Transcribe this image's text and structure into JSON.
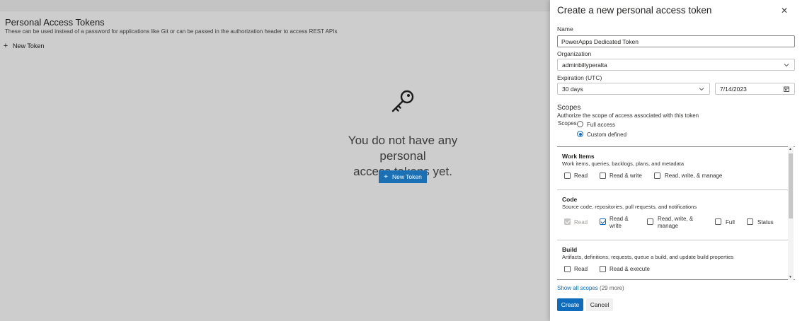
{
  "background": {
    "page_title": "Personal Access Tokens",
    "page_subtitle": "These can be used instead of a password for applications like Git or can be passed in the authorization header to access REST APIs",
    "new_token_link": "New Token",
    "empty_message_line1": "You do not have any personal",
    "empty_message_line2": "access tokens yet.",
    "new_token_button": "New Token",
    "empty_icon": "key-icon"
  },
  "panel": {
    "title": "Create a new personal access token",
    "close_icon": "close-icon",
    "name_label": "Name",
    "name_value": "PowerApps Dedicated Token",
    "organization_label": "Organization",
    "organization_value": "adminbillyperalta",
    "expiration_label": "Expiration (UTC)",
    "expiration_value": "30 days",
    "expiration_date": "7/14/2023",
    "scopes_heading": "Scopes",
    "scopes_description": "Authorize the scope of access associated with this token",
    "scopes_radio_label": "Scopes",
    "radio_full": "Full access",
    "radio_custom": "Custom defined",
    "selected_radio": "Custom defined",
    "sections": [
      {
        "name": "Work Items",
        "description": "Work items, queries, backlogs, plans, and metadata",
        "options": [
          {
            "label": "Read",
            "checked": false,
            "disabled": false
          },
          {
            "label": "Read & write",
            "checked": false,
            "disabled": false
          },
          {
            "label": "Read, write, & manage",
            "checked": false,
            "disabled": false
          }
        ]
      },
      {
        "name": "Code",
        "description": "Source code, repositories, pull requests, and notifications",
        "options": [
          {
            "label": "Read",
            "checked": true,
            "disabled": true
          },
          {
            "label_line1": "Read &",
            "label_line2": "write",
            "checked": true,
            "disabled": false
          },
          {
            "label_line1": "Read, write, &",
            "label_line2": "manage",
            "checked": false,
            "disabled": false
          },
          {
            "label": "Full",
            "checked": false,
            "disabled": false
          },
          {
            "label": "Status",
            "checked": false,
            "disabled": false
          }
        ]
      },
      {
        "name": "Build",
        "description": "Artifacts, definitions, requests, queue a build, and update build properties",
        "options": [
          {
            "label": "Read",
            "checked": false,
            "disabled": false
          },
          {
            "label": "Read & execute",
            "checked": false,
            "disabled": false
          }
        ]
      }
    ],
    "show_all_link": "Show all scopes",
    "show_all_count": "(29 more)",
    "create_button": "Create",
    "cancel_button": "Cancel"
  },
  "colors": {
    "accent": "#0f6cbd",
    "overlay_background": "#cdcdcd",
    "panel_background": "#ffffff"
  }
}
